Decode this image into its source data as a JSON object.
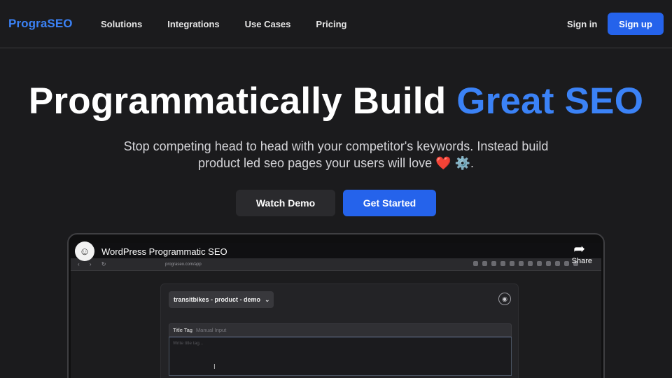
{
  "brand": {
    "logo_text": "PrograSEO",
    "accent_color": "#3b82f6",
    "primary_button_color": "#2563eb"
  },
  "nav": {
    "links": [
      "Solutions",
      "Integrations",
      "Use Cases",
      "Pricing"
    ],
    "sign_in": "Sign in",
    "sign_up": "Sign up"
  },
  "hero": {
    "title_main": "Programmatically Build ",
    "title_accent": "Great SEO",
    "subtitle_line1": "Stop competing head to head with your competitor's keywords. Instead build",
    "subtitle_line2": "product led seo pages your users will love ❤️ ⚙️.",
    "watch_demo": "Watch Demo",
    "get_started": "Get Started"
  },
  "video": {
    "title": "WordPress Programmatic SEO",
    "share_label": "Share",
    "share_icon": "share-arrow-icon",
    "url": "prograseo.com/app",
    "app": {
      "project_dropdown": "transitbikes - product - demo",
      "field_label": "Title Tag",
      "field_hint": "Manual Input",
      "field_placeholder": "Write title tag..."
    }
  }
}
